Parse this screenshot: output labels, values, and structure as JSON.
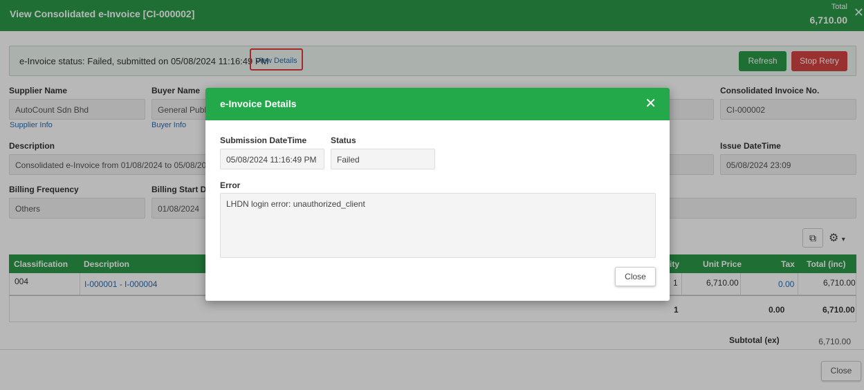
{
  "header": {
    "title": "View Consolidated e-Invoice [CI-000002]",
    "total_label": "Total",
    "total_value": "6,710.00"
  },
  "status_bar": {
    "text": "e-Invoice status: Failed, submitted on 05/08/2024 11:16:49 PM",
    "view_details": "View Details",
    "refresh": "Refresh",
    "stop_retry": "Stop Retry",
    "colors": {
      "refresh": "#2c9a49",
      "stop_retry": "#d64545",
      "highlight": "#e53935"
    }
  },
  "form": {
    "supplier_name_label": "Supplier Name",
    "supplier_name": "AutoCount Sdn Bhd",
    "supplier_info": "Supplier Info",
    "buyer_name_label": "Buyer Name",
    "buyer_name": "General Public",
    "buyer_info": "Buyer Info",
    "consolidated_no_label": "Consolidated Invoice No.",
    "consolidated_no": "CI-000002",
    "description_label": "Description",
    "description": "Consolidated e-Invoice from 01/08/2024 to 05/08/2024",
    "issue_datetime_label": "Issue DateTime",
    "issue_datetime": "05/08/2024 23:09",
    "billing_frequency_label": "Billing Frequency",
    "billing_frequency": "Others",
    "billing_start_label": "Billing Start Dat",
    "billing_start": "01/08/2024"
  },
  "table": {
    "columns": [
      "Classification",
      "Description",
      "ity",
      "Unit Price",
      "Tax",
      "Total (inc)"
    ],
    "rows": [
      {
        "classification": "004",
        "description": "I-000001 - I-000004",
        "qty": "1",
        "unit_price": "6,710.00",
        "tax": "0.00",
        "total": "6,710.00"
      }
    ],
    "footer": {
      "qty": "1",
      "tax": "0.00",
      "total": "6,710.00"
    }
  },
  "subtotal": {
    "label": "Subtotal (ex)",
    "value": "6,710.00"
  },
  "main_close": "Close",
  "modal": {
    "title": "e-Invoice Details",
    "submission_label": "Submission DateTime",
    "submission_value": "05/08/2024 11:16:49 PM",
    "status_label": "Status",
    "status_value": "Failed",
    "error_label": "Error",
    "error_value": "LHDN login error: unauthorized_client",
    "close": "Close",
    "header_color": "#23a84a"
  },
  "icons": {
    "header_close": "close-icon",
    "column_chooser": "columns-icon",
    "settings": "gear-icon",
    "modal_close": "close-icon"
  }
}
